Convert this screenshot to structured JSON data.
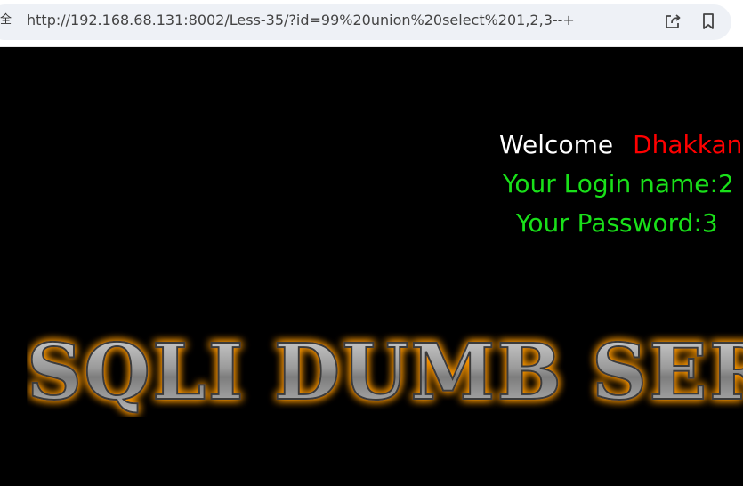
{
  "browser": {
    "security_label": "全",
    "url": "http://192.168.68.131:8002/Less-35/?id=99%20union%20select%201,2,3--+",
    "icons": [
      "share-icon",
      "bookmark-icon"
    ]
  },
  "page": {
    "welcome_word": "Welcome",
    "welcome_name": "Dhakkan",
    "login_text": "Your Login name:2",
    "password_text": "Your Password:3",
    "banner_text": "SQLI DUMB SERIES",
    "colors": {
      "background": "#000000",
      "welcome": "#ffffff",
      "name": "#ff0000",
      "result": "#19e019",
      "banner_glow": "#ff9900"
    }
  }
}
